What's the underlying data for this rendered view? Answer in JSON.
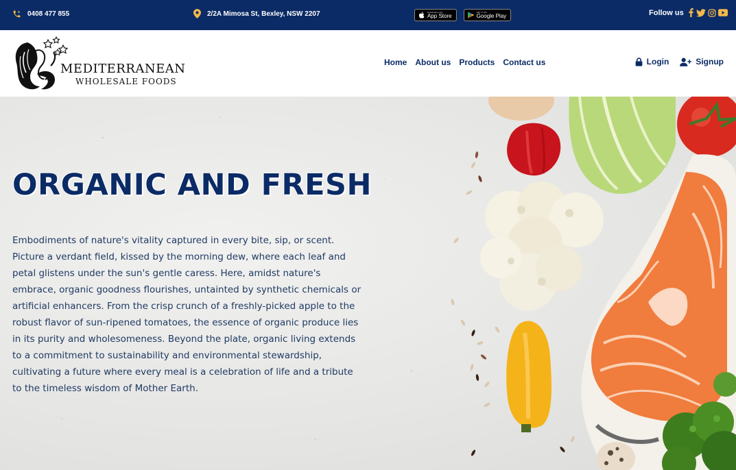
{
  "topbar": {
    "phone": "0408 477 855",
    "address": "2/2A Mimosa St, Bexley, NSW 2207",
    "app_store_small": "Download on the",
    "app_store_label": "App Store",
    "google_play_small": "GET IT ON",
    "google_play_label": "Google Play",
    "follow_label": "Follow us",
    "social_icons": [
      "facebook-icon",
      "twitter-icon",
      "instagram-icon",
      "youtube-icon"
    ]
  },
  "header": {
    "logo_line1": "MEDITERRANEAN",
    "logo_line2": "WHOLESALE FOODS",
    "nav": [
      "Home",
      "About us",
      "Products",
      "Contact us"
    ],
    "login": "Login",
    "signup": "Signup"
  },
  "hero": {
    "title": "ORGANIC AND FRESH",
    "body": "Embodiments of nature's vitality captured in every bite, sip, or scent. Picture a verdant field, kissed by the morning dew, where each leaf and petal glistens under the sun's gentle caress. Here, amidst nature's embrace, organic goodness flourishes, untainted by synthetic chemicals or artificial enhancers. From the crisp crunch of a freshly-picked apple to the robust flavor of sun-ripened tomatoes, the essence of organic produce lies in its purity and wholesomeness. Beyond the plate, organic living extends to a commitment to sustainability and environmental stewardship, cultivating a future where every meal is a celebration of life and a tribute to the timeless wisdom of Mother Earth."
  },
  "colors": {
    "brand_navy": "#0b2b66",
    "accent_gold": "#f3b74a",
    "salmon": "#f07c3d"
  }
}
